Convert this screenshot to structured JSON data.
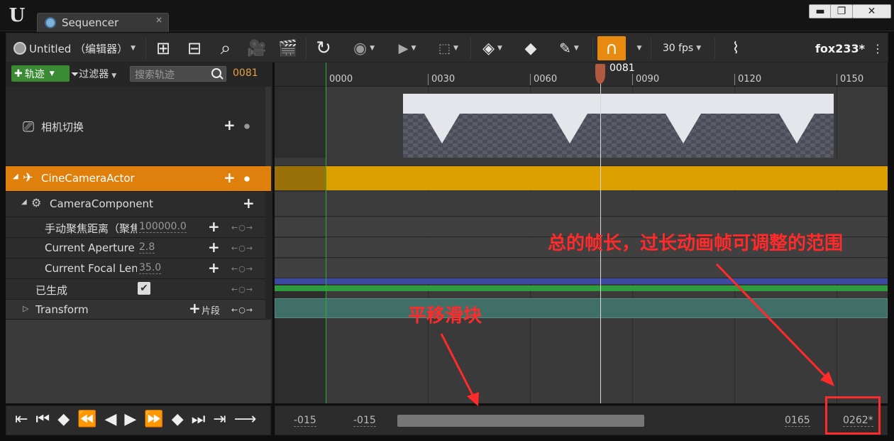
{
  "window": {
    "tab_title": "Sequencer",
    "tab_close": "×",
    "minimize": "▬",
    "maximize": "❐",
    "close": "✕"
  },
  "toolbar": {
    "sequence_name": "Untitled （编辑器）",
    "fps": "30 fps",
    "user_label": "fox233*",
    "icons": [
      "save-icon",
      "save-as-icon",
      "find-icon",
      "camera-icon",
      "render-clapper-icon",
      "loop-icon",
      "eye-icon",
      "play-icon",
      "selection-icon",
      "key-icon",
      "auto-key-icon",
      "pencil-icon",
      "magnet-icon",
      "curve-editor-icon"
    ]
  },
  "track_panel": {
    "tracks_button": "轨迹",
    "filter_button": "过滤器",
    "search_placeholder": "搜索轨迹",
    "current_frame": "0081"
  },
  "tracks": [
    {
      "label": "相机切换"
    },
    {
      "label": "CineCameraActor"
    },
    {
      "label": "CameraComponent"
    },
    {
      "label": "手动聚焦距离（聚焦",
      "value": "100000.0"
    },
    {
      "label": "Current Aperture",
      "value": "2.8"
    },
    {
      "label": "Current Focal Leng",
      "value": "35.0"
    },
    {
      "label": "已生成",
      "checked": true
    },
    {
      "label": "Transform",
      "extra": "片段"
    }
  ],
  "ruler": {
    "ticks": [
      "0000",
      "0030",
      "0060",
      "0090",
      "0120",
      "0150"
    ],
    "playhead": "0081"
  },
  "range": {
    "view_start": "-015",
    "work_start": "-015",
    "view_end": "0165",
    "total_end": "0262*"
  },
  "transport_glyphs": "⇤ ⏮ ◆ ⏪ ◀ ▶ ⏩ ◆ ⏭ ⇥ ⟶",
  "annotations": {
    "total_length": "总的帧长，过长动画帧可调整的范围",
    "pan_slider": "平移滑块"
  },
  "colors": {
    "actor_track": "#dba000",
    "selected_row": "#e0800c",
    "annotation": "#ff2a2a",
    "tracks_button": "#3b8a34"
  }
}
